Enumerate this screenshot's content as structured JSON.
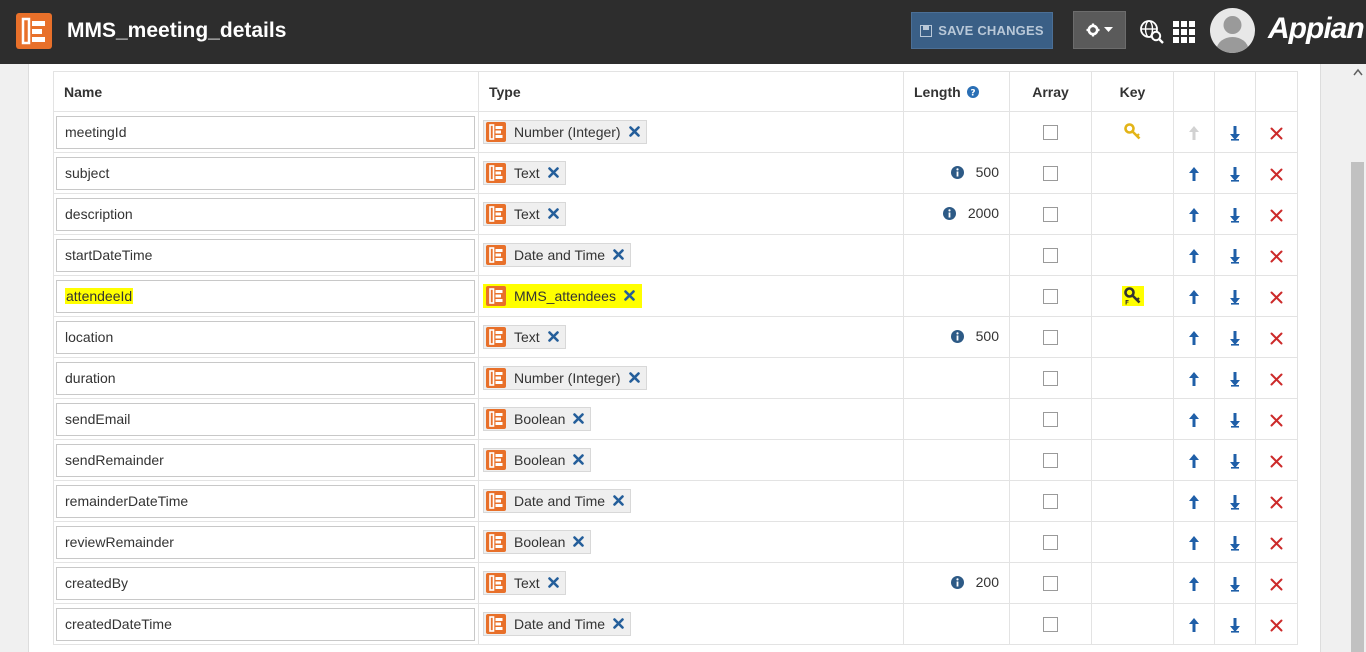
{
  "header": {
    "title": "MMS_meeting_details",
    "save_label": "SAVE CHANGES",
    "brand": "Appian"
  },
  "table": {
    "columns": {
      "name": "Name",
      "type": "Type",
      "length": "Length",
      "array": "Array",
      "key": "Key"
    },
    "rows": [
      {
        "name": "meetingId",
        "type": "Number (Integer)",
        "length": "",
        "key": "primary",
        "up_enabled": false
      },
      {
        "name": "subject",
        "type": "Text",
        "length": "500",
        "key": "",
        "up_enabled": true
      },
      {
        "name": "description",
        "type": "Text",
        "length": "2000",
        "key": "",
        "up_enabled": true
      },
      {
        "name": "startDateTime",
        "type": "Date and Time",
        "length": "",
        "key": "",
        "up_enabled": true
      },
      {
        "name": "attendeeId",
        "type": "MMS_attendees",
        "length": "",
        "key": "foreign",
        "up_enabled": true,
        "highlight": true
      },
      {
        "name": "location",
        "type": "Text",
        "length": "500",
        "key": "",
        "up_enabled": true
      },
      {
        "name": "duration",
        "type": "Number (Integer)",
        "length": "",
        "key": "",
        "up_enabled": true
      },
      {
        "name": "sendEmail",
        "type": "Boolean",
        "length": "",
        "key": "",
        "up_enabled": true
      },
      {
        "name": "sendRemainder",
        "type": "Boolean",
        "length": "",
        "key": "",
        "up_enabled": true
      },
      {
        "name": "remainderDateTime",
        "type": "Date and Time",
        "length": "",
        "key": "",
        "up_enabled": true
      },
      {
        "name": "reviewRemainder",
        "type": "Boolean",
        "length": "",
        "key": "",
        "up_enabled": true
      },
      {
        "name": "createdBy",
        "type": "Text",
        "length": "200",
        "key": "",
        "up_enabled": true
      },
      {
        "name": "createdDateTime",
        "type": "Date and Time",
        "length": "",
        "key": "",
        "up_enabled": true
      }
    ]
  },
  "colors": {
    "header_bg": "#2d2d2d",
    "logo_orange": "#e8702a",
    "save_button_bg": "#3a5f86",
    "arrow_blue": "#1f5fa8",
    "delete_red": "#cc2a2a",
    "highlight_yellow": "#ffff00",
    "key_gold": "#e3b417"
  }
}
